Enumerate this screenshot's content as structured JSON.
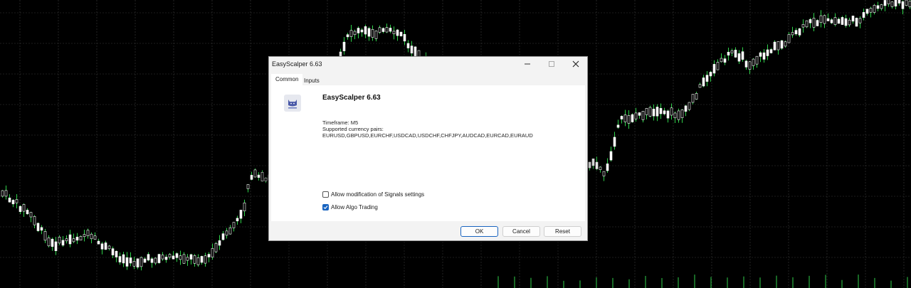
{
  "dialog": {
    "title": "EasyScalper 6.63",
    "tabs": [
      {
        "label": "Common"
      },
      {
        "label": "Inputs"
      }
    ],
    "ea_name": "EasyScalper 6.63",
    "description": [
      "Timeframe: M5",
      "Supported currency pairs:",
      "EURUSD,GBPUSD,EURCHF,USDCAD,USDCHF,CHFJPY,AUDCAD,EURCAD,EURAUD"
    ],
    "options": [
      {
        "label": "Allow modification of Signals settings",
        "checked": false
      },
      {
        "label": "Allow Algo Trading",
        "checked": true
      }
    ],
    "buttons": {
      "ok": "OK",
      "cancel": "Cancel",
      "reset": "Reset"
    }
  },
  "chart": {
    "background": "#000000",
    "grid_color": "#3a3a3a",
    "candle_color": "#ffffff",
    "wick_color": "#2fd14a"
  }
}
